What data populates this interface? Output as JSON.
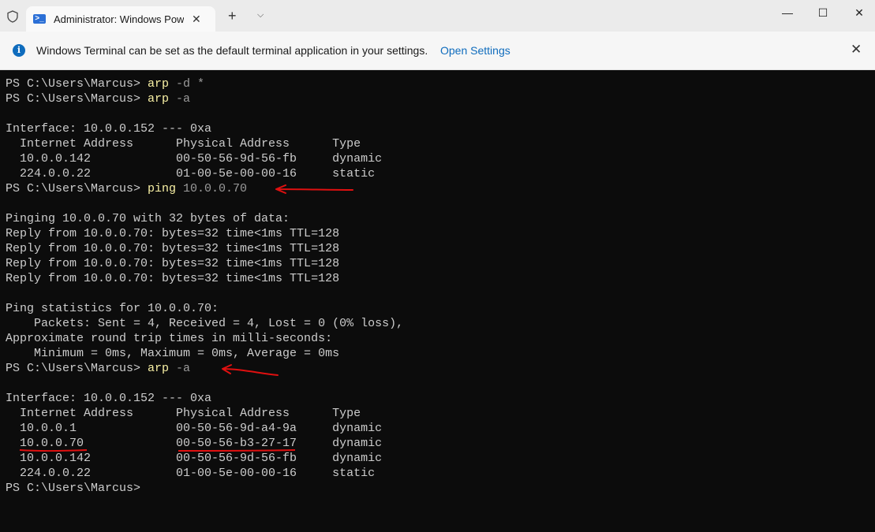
{
  "tab": {
    "title": "Administrator: Windows PowerShell",
    "ps_glyph": ">_",
    "close": "✕"
  },
  "titlebar": {
    "new_tab": "+",
    "dropdown": "⌵",
    "minimize": "—",
    "maximize": "☐",
    "close": "✕"
  },
  "infobar": {
    "text": "Windows Terminal can be set as the default terminal application in your settings.",
    "link": "Open Settings",
    "icon": "i",
    "close": "✕"
  },
  "terminal": {
    "lines": [
      {
        "p": "PS C:\\Users\\Marcus> ",
        "c": "arp",
        "a": " -d *"
      },
      {
        "p": "PS C:\\Users\\Marcus> ",
        "c": "arp",
        "a": " -a"
      },
      {
        "p": ""
      },
      {
        "p": "Interface: 10.0.0.152 --- 0xa"
      },
      {
        "p": "  Internet Address      Physical Address      Type"
      },
      {
        "p": "  10.0.0.142            00-50-56-9d-56-fb     dynamic"
      },
      {
        "p": "  224.0.0.22            01-00-5e-00-00-16     static"
      },
      {
        "p": "PS C:\\Users\\Marcus> ",
        "c": "ping",
        "a": " 10.0.0.70"
      },
      {
        "p": ""
      },
      {
        "p": "Pinging 10.0.0.70 with 32 bytes of data:"
      },
      {
        "p": "Reply from 10.0.0.70: bytes=32 time<1ms TTL=128"
      },
      {
        "p": "Reply from 10.0.0.70: bytes=32 time<1ms TTL=128"
      },
      {
        "p": "Reply from 10.0.0.70: bytes=32 time<1ms TTL=128"
      },
      {
        "p": "Reply from 10.0.0.70: bytes=32 time<1ms TTL=128"
      },
      {
        "p": ""
      },
      {
        "p": "Ping statistics for 10.0.0.70:"
      },
      {
        "p": "    Packets: Sent = 4, Received = 4, Lost = 0 (0% loss),"
      },
      {
        "p": "Approximate round trip times in milli-seconds:"
      },
      {
        "p": "    Minimum = 0ms, Maximum = 0ms, Average = 0ms"
      },
      {
        "p": "PS C:\\Users\\Marcus> ",
        "c": "arp",
        "a": " -a"
      },
      {
        "p": ""
      },
      {
        "p": "Interface: 10.0.0.152 --- 0xa"
      },
      {
        "p": "  Internet Address      Physical Address      Type"
      },
      {
        "p": "  10.0.0.1              00-50-56-9d-a4-9a     dynamic"
      },
      {
        "p": "  10.0.0.70             00-50-56-b3-27-17     dynamic"
      },
      {
        "p": "  10.0.0.142            00-50-56-9d-56-fb     dynamic"
      },
      {
        "p": "  224.0.0.22            01-00-5e-00-00-16     static"
      },
      {
        "p": "PS C:\\Users\\Marcus> "
      }
    ]
  },
  "colors": {
    "annotation": "#e01010",
    "command": "#f9f1a5"
  }
}
